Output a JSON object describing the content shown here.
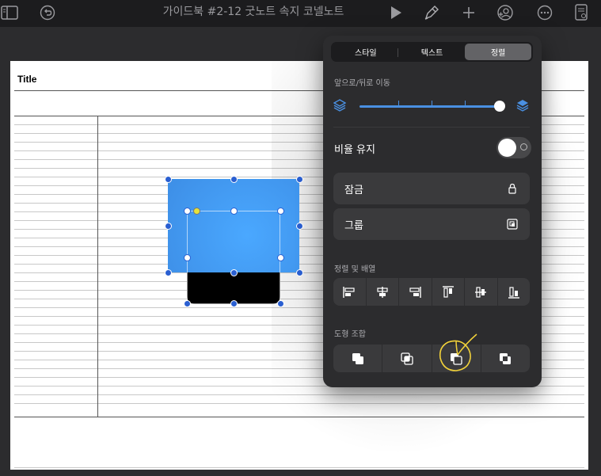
{
  "topbar": {
    "title": "가이드북 #2-12 굿노트 속지 코넬노트",
    "icons": [
      "sidebar-icon",
      "undo-icon",
      "play-icon",
      "pen-brush-icon",
      "plus-icon",
      "add-collaborator-icon",
      "more-icon",
      "doc-info-icon"
    ]
  },
  "page": {
    "title": "Title"
  },
  "popover": {
    "tabs": [
      {
        "label": "스타일"
      },
      {
        "label": "텍스트"
      },
      {
        "label": "정렬"
      }
    ],
    "active_tab": "정렬",
    "order_section_label": "앞으로/뒤로 이동",
    "order_slider_value": 1.0,
    "aspect_label": "비율 유지",
    "aspect_toggle_on": false,
    "lock_label": "잠금",
    "group_label": "그룹",
    "align_section_label": "정렬 및 배열",
    "combine_section_label": "도형 조합"
  },
  "colors": {
    "accent": "#4a90e2",
    "shape_blue": "#3d8ee6",
    "handle": "#2a5fd1",
    "annotation": "#f2d23a"
  }
}
